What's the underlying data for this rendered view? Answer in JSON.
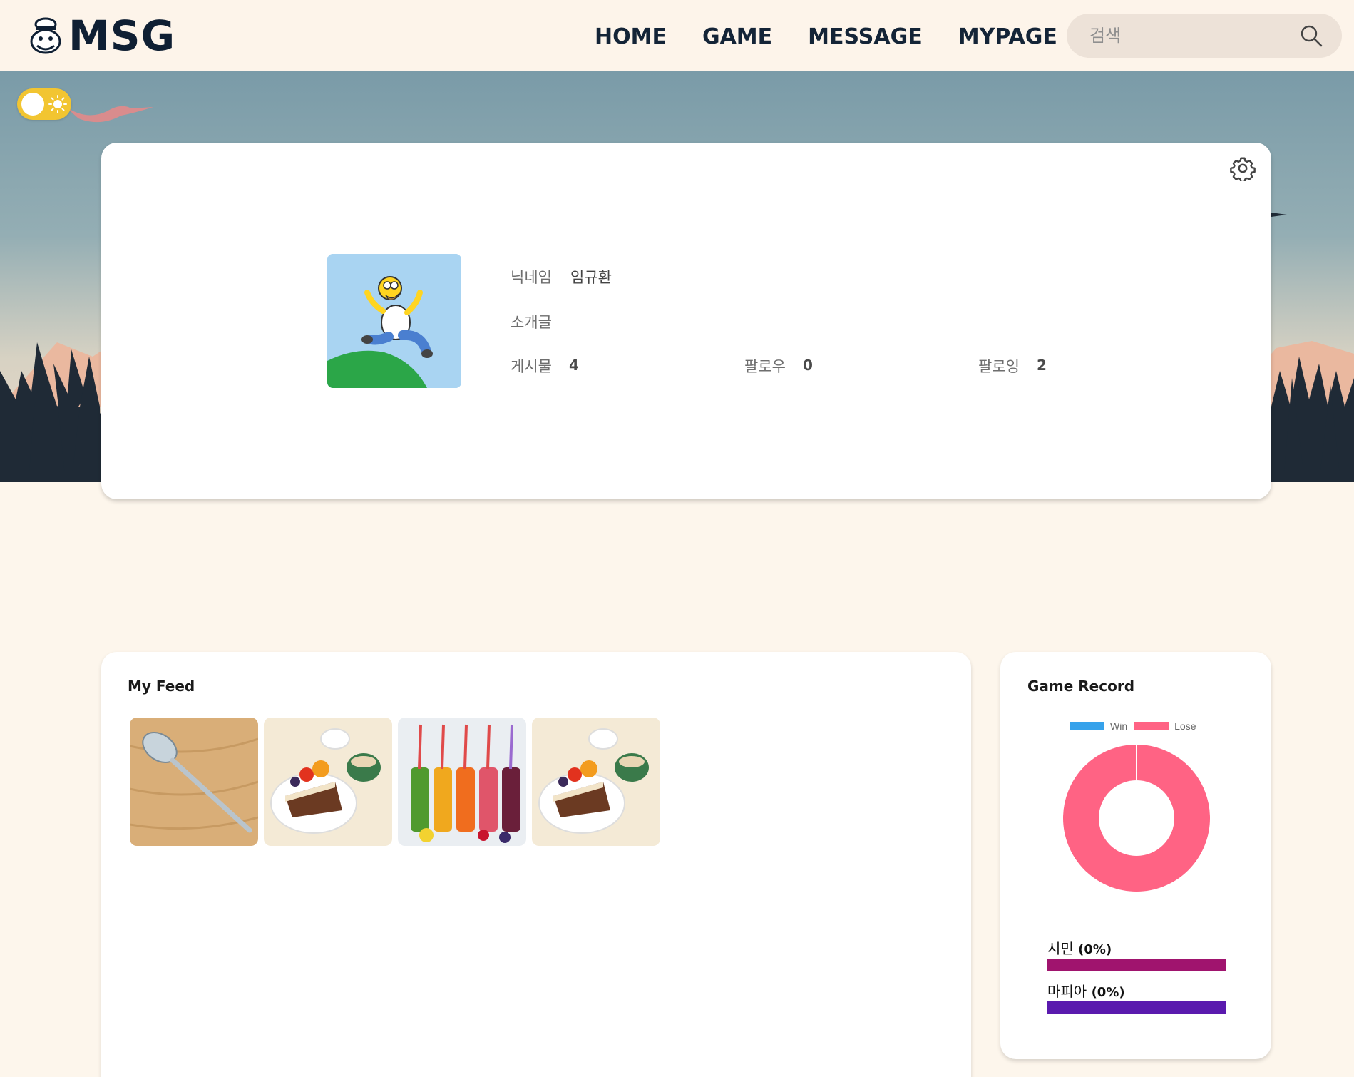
{
  "brand": {
    "name": "MSG"
  },
  "nav": [
    {
      "label": "HOME"
    },
    {
      "label": "GAME"
    },
    {
      "label": "MESSAGE"
    },
    {
      "label": "MYPAGE"
    }
  ],
  "search": {
    "placeholder": "검색",
    "icon": "search-icon"
  },
  "theme_toggle": {
    "state": "light",
    "icon": "sun-icon"
  },
  "profile": {
    "nickname_label": "닉네임",
    "nickname": "임규환",
    "intro_label": "소개글",
    "intro": "",
    "posts_label": "게시물",
    "posts": "4",
    "followers_label": "팔로우",
    "followers": "0",
    "following_label": "팔로잉",
    "following": "2",
    "settings_icon": "gear-icon"
  },
  "feed": {
    "title": "My Feed",
    "items": [
      {
        "subject": "spoon"
      },
      {
        "subject": "cake and fruit"
      },
      {
        "subject": "juice bottles"
      },
      {
        "subject": "cake and fruit"
      }
    ]
  },
  "record": {
    "title": "Game Record",
    "legend": [
      {
        "label": "Win",
        "color": "#36a2eb"
      },
      {
        "label": "Lose",
        "color": "#ff6384"
      }
    ],
    "roles": [
      {
        "label": "시민",
        "pct": "(0%)",
        "color": "#a0146e"
      },
      {
        "label": "마피아",
        "pct": "(0%)",
        "color": "#5a1aae"
      }
    ]
  },
  "chart_data": {
    "type": "pie",
    "categories": [
      "Win",
      "Lose"
    ],
    "values": [
      0,
      1
    ],
    "colors": [
      "#36a2eb",
      "#ff6384"
    ],
    "legend": "top"
  }
}
